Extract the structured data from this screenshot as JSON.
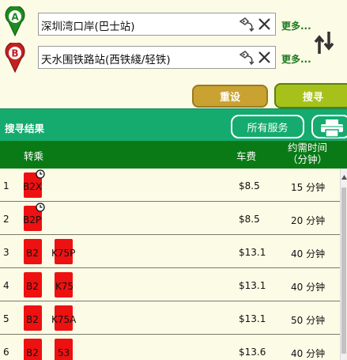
{
  "origin": {
    "marker": "A",
    "value": "深圳湾口岸(巴士站)",
    "more_label": "更多..."
  },
  "destination": {
    "marker": "B",
    "value": "天水围铁路站(西铁綫/轻铁)",
    "more_label": "更多..."
  },
  "buttons": {
    "reset": "重设",
    "search": "搜寻"
  },
  "results": {
    "title": "搜寻结果",
    "all_services": "所有服务"
  },
  "columns": {
    "transfer": "转乘",
    "fare": "车费",
    "time_line1": "约需时间",
    "time_line2": "（分钟）"
  },
  "rows": [
    {
      "num": "1",
      "routes": [
        "B2X"
      ],
      "clock": true,
      "fare": "$8.5",
      "time": "15 分钟"
    },
    {
      "num": "2",
      "routes": [
        "B2P"
      ],
      "clock": true,
      "fare": "$8.5",
      "time": "20 分钟"
    },
    {
      "num": "3",
      "routes": [
        "B2",
        "K75P"
      ],
      "clock": false,
      "fare": "$13.1",
      "time": "40 分钟"
    },
    {
      "num": "4",
      "routes": [
        "B2",
        "K75"
      ],
      "clock": false,
      "fare": "$13.1",
      "time": "40 分钟"
    },
    {
      "num": "5",
      "routes": [
        "B2",
        "K75A"
      ],
      "clock": false,
      "fare": "$13.1",
      "time": "50 分钟"
    },
    {
      "num": "6",
      "routes": [
        "B2",
        "53"
      ],
      "clock": false,
      "fare": "$13.6",
      "time": "40 分钟"
    }
  ],
  "icons": {
    "origin_marker": "map-pin-a-icon",
    "destination_marker": "map-pin-b-icon",
    "locate": "location-tag-icon",
    "clear": "close-icon",
    "swap": "swap-arrows-icon",
    "print": "printer-icon",
    "bus": "bus-route-icon",
    "schedule": "clock-icon"
  },
  "colors": {
    "page_bg": "#fbfbe6",
    "results_bar": "#15ab6e",
    "column_header": "#0a7a17",
    "reset_button": "#c9a232",
    "search_button": "#a6c21a",
    "more_link": "#1e7a1e",
    "bus_route": "#ee1111"
  }
}
